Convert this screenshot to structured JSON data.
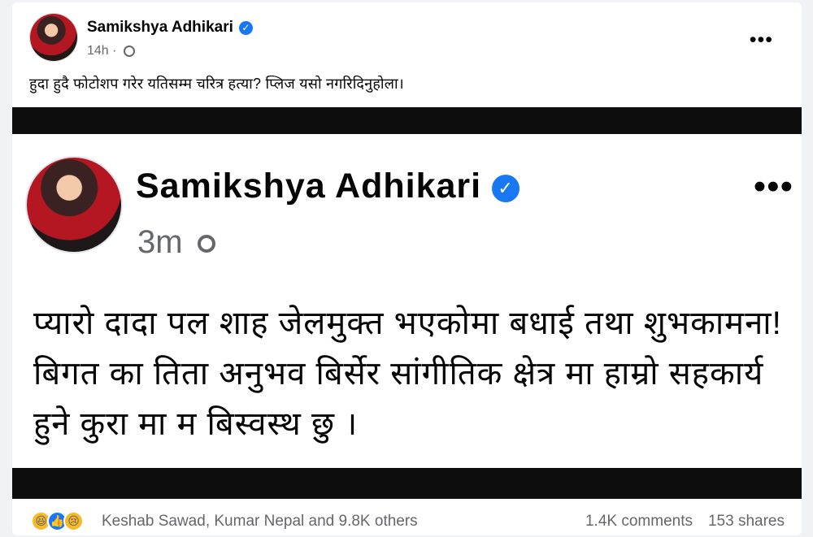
{
  "post": {
    "author": "Samikshya Adhikari",
    "time": "14h",
    "caption": "हुदा हुदै फोटोशप गरेर यतिसम्म चरित्र हत्या? प्लिज यसो नगरिदिनुहोला।",
    "icons": [
      "avatar",
      "verified-badge",
      "globe-icon",
      "more-options-icon"
    ]
  },
  "shared_post": {
    "author": "Samikshya Adhikari",
    "time": "3m",
    "body": "प्यारो दादा पल शाह जेलमुक्त भएकोमा बधाई तथा शुभकामना! बिगत का तिता अनुभव बिर्सेर सांगीतिक क्षेत्र मा हाम्रो सहकार्य हुने कुरा मा म बिस्वस्थ छु ।",
    "icons": [
      "avatar",
      "verified-badge",
      "globe-icon",
      "more-options-icon"
    ]
  },
  "footer": {
    "reaction_icons": [
      "haha-icon",
      "like-icon",
      "sad-icon"
    ],
    "reaction_text": "Keshab Sawad, Kumar Nepal and 9.8K others",
    "comments": "1.4K comments",
    "shares": "153 shares"
  },
  "colors": {
    "facebook_blue": "#1877f2",
    "secondary_text": "#65676b",
    "dark_band": "#0d0d0d",
    "page_bg": "#f0f2f5"
  }
}
